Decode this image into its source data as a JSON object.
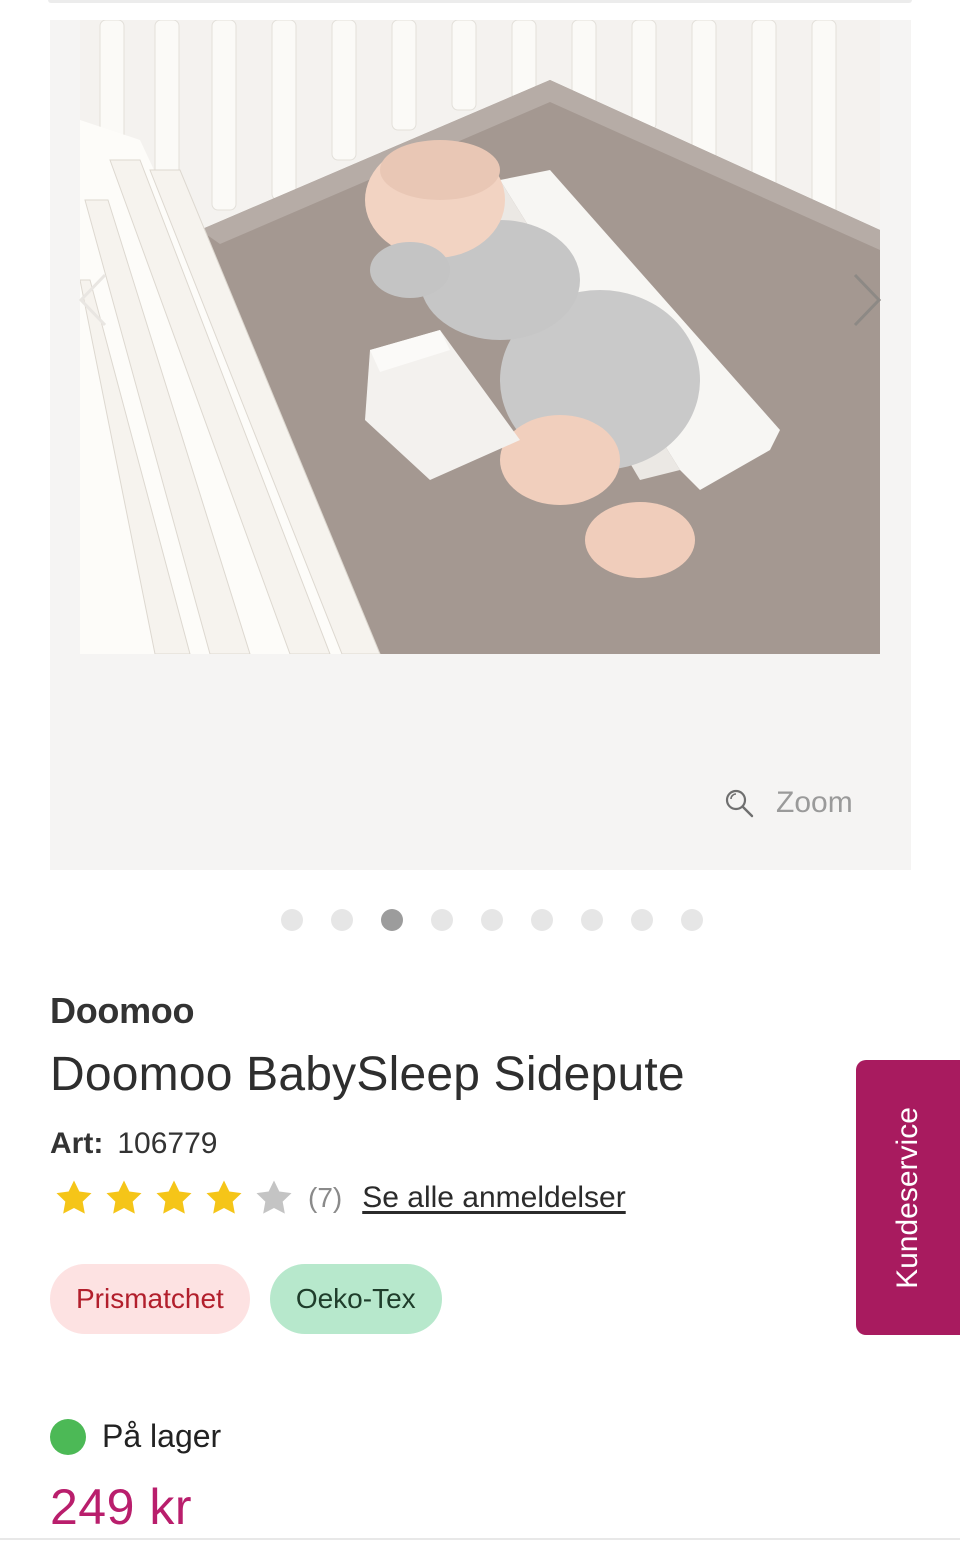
{
  "gallery": {
    "image_alt": "Doomoo BabySleep Sidepute product photo",
    "prev_icon": "chevron-left-icon",
    "next_icon": "chevron-right-icon",
    "zoom_label": "Zoom",
    "dots_total": 9,
    "active_dot_index": 2
  },
  "product": {
    "brand": "Doomoo",
    "title": "Doomoo BabySleep Sidepute",
    "art_label": "Art:",
    "art_number": "106779",
    "rating": {
      "value": 4,
      "max": 5,
      "count_text": "(7)"
    },
    "reviews_link": "Se alle anmeldelser",
    "badges": [
      "Prismatchet",
      "Oeko-Tex"
    ],
    "stock": "På lager",
    "price": "249 kr"
  },
  "side_tab": {
    "label": "Kundeservice"
  },
  "colors": {
    "accent": "#a81b5f",
    "price": "#b91e6c",
    "stock": "#4cb956",
    "star": "#f5c518",
    "star_empty": "#c4c4c4"
  }
}
